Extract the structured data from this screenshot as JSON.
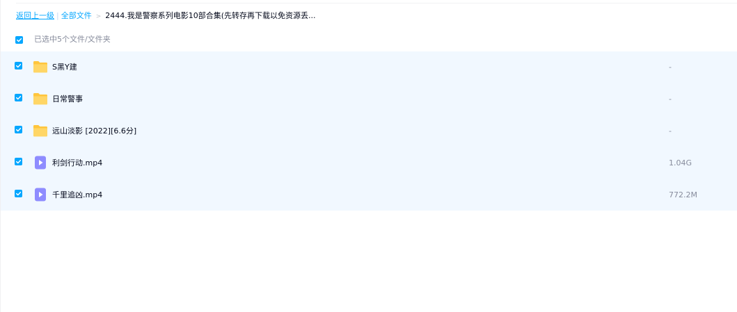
{
  "breadcrumb": {
    "back_label": "返回上一级",
    "separator": "|",
    "root_label": "全部文件",
    "arrow": ">",
    "current_label": "2444.我是警察系列电影10部合集(先转存再下载以免资源丢..."
  },
  "selection": {
    "summary": "已选中5个文件/文件夹"
  },
  "files": [
    {
      "name": "S黑Y建",
      "size": "-",
      "type": "folder",
      "icon": "folder-icon"
    },
    {
      "name": "日常警事",
      "size": "-",
      "type": "folder",
      "icon": "folder-icon"
    },
    {
      "name": "远山淡影 [2022][6.6分]",
      "size": "-",
      "type": "folder",
      "icon": "folder-icon"
    },
    {
      "name": "利剑行动.mp4",
      "size": "1.04G",
      "type": "video",
      "icon": "video-file-icon"
    },
    {
      "name": "千里追凶.mp4",
      "size": "772.2M",
      "type": "video",
      "icon": "video-file-icon"
    }
  ],
  "colors": {
    "accent": "#06a7ff",
    "selected_row_bg": "#f1f8ff",
    "folder": "#ffc53d",
    "video": "#8e8cff"
  }
}
